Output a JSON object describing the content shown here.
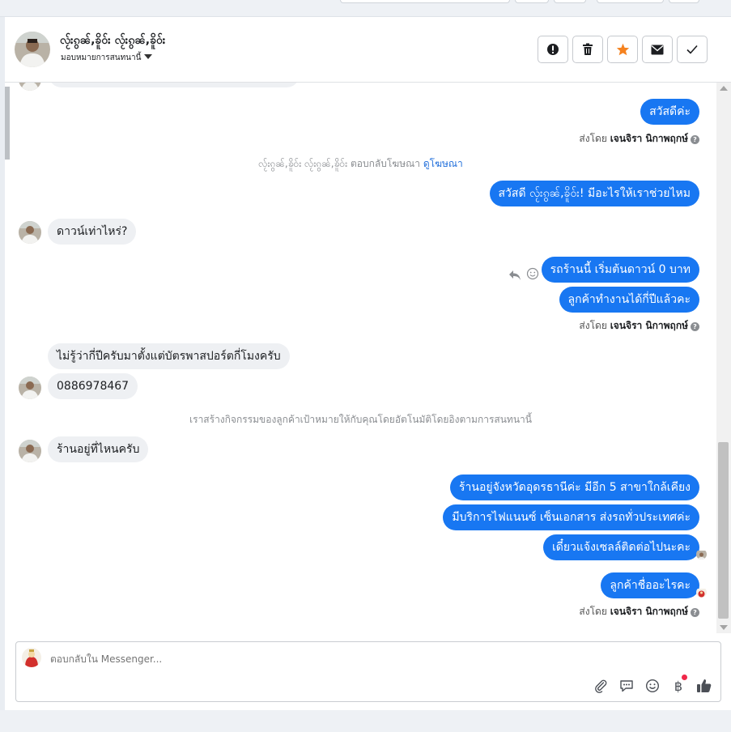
{
  "header": {
    "contact_name": "လႂ်းၵွၼ်,ၶိူဝ်း လႂ်းၵွၼ်,ၶိူဝ်း",
    "assign_label": "มอบหมายการสนทนานี้",
    "buttons": [
      {
        "name": "mark-spam-button",
        "icon": "exclamation-icon"
      },
      {
        "name": "delete-button",
        "icon": "trash-icon"
      },
      {
        "name": "star-button",
        "icon": "star-icon"
      },
      {
        "name": "mark-unread-button",
        "icon": "envelope-icon"
      },
      {
        "name": "mark-done-button",
        "icon": "check-icon"
      }
    ]
  },
  "messages": {
    "m1": "สวัสดีค่ะ",
    "m2": "สวัสดี လႂ်းၵွၼ်,ၶိူဝ်း! มีอะไรให้เราช่วยไหม",
    "m3": "ดาวน์เท่าไหร่?",
    "m4": "รถร้านนี้ เริ่มต้นดาวน์ 0 บาท",
    "m5": "ลูกค้าทำงานได้กี่ปีแล้วคะ",
    "m6": "ไม่รู้ว่ากี่ปีครับมาตั้งแต่บัตรพาสปอร์ตกี่โมงครับ",
    "m7": "0886978467",
    "m8": "ร้านอยู่ที่ไหนครับ",
    "m9": "ร้านอยู่จังหวัดอุดรธานีค่ะ มีอีก 5 สาขาใกล้เคียง",
    "m10": "มีบริการไฟแนนซ์ เซ็นเอกสาร ส่งรถทั่วประเทศค่ะ",
    "m11": "เดี๋ยวแจ้งเซลล์ติดต่อไปนะคะ",
    "m12": "ลูกค้าชื่ออะไรคะ"
  },
  "sent_by": {
    "prefix": "ส่งโดย",
    "agent": "เจนจิรา นิกาพฤกษ์"
  },
  "system": {
    "ad_reply": "လႂ်းၵွၼ်,ၶိူဝ်း လႂ်းၵွၼ်,ၶိူဝ်း ตอบกลับโฆษณา",
    "ad_link": "ดูโฆษณา",
    "activity_note": "เราสร้างกิจกรรมของลูกค้าเป้าหมายให้กับคุณโดยอัตโนมัติโดยอิงตามการสนทนานี้"
  },
  "composer": {
    "placeholder": "ตอบกลับใน Messenger...",
    "icons": [
      "paperclip-icon",
      "saved-reply-icon",
      "emoji-icon",
      "baht-payment-icon",
      "thumbs-up-icon"
    ]
  },
  "colors": {
    "outgoing_bubble": "#1877f2",
    "incoming_bubble": "#eef0f3",
    "link": "#216fdb",
    "star": "#f5821f",
    "notification_dot": "#f02849"
  }
}
